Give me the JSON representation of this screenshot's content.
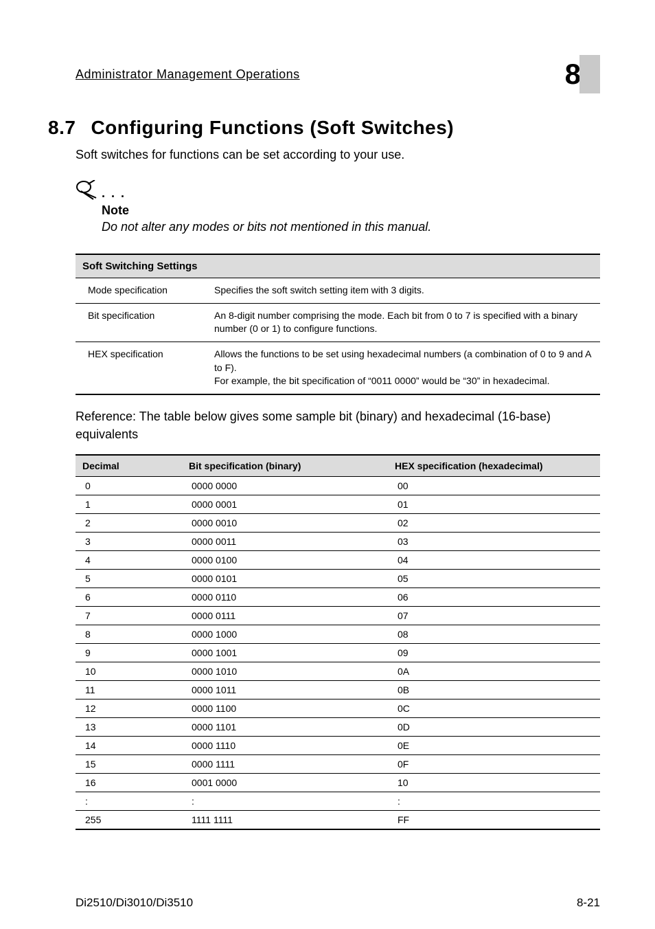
{
  "running_head": {
    "title": "Administrator Management Operations",
    "chapter_number": "8"
  },
  "section": {
    "number": "8.7",
    "title": "Configuring Functions (Soft Switches)",
    "intro": "Soft switches for functions can be set according to your use."
  },
  "note": {
    "label": "Note",
    "text": "Do not alter any modes or bits not mentioned in this manual."
  },
  "table1": {
    "header": "Soft Switching Settings",
    "rows": [
      {
        "c1": "Mode specification",
        "c2": "Specifies the soft switch setting item with 3 digits."
      },
      {
        "c1": "Bit specification",
        "c2": "An 8-digit number comprising the mode. Each bit from 0 to 7 is specified with a binary number (0 or 1) to configure functions."
      },
      {
        "c1": "HEX specification",
        "c2": "Allows the functions to be set using hexadecimal numbers (a combination of 0 to 9 and A to F).\nFor example, the bit specification of “0011 0000” would be “30” in hexadecimal."
      }
    ]
  },
  "reference_text": "Reference: The table below gives some sample bit (binary) and hexadecimal (16-base) equivalents",
  "table2": {
    "headers": [
      "Decimal",
      "Bit specification (binary)",
      "HEX specification (hexadecimal)"
    ],
    "rows": [
      {
        "dec": "0",
        "bin": "0000 0000",
        "hex": "00"
      },
      {
        "dec": "1",
        "bin": "0000 0001",
        "hex": "01"
      },
      {
        "dec": "2",
        "bin": "0000 0010",
        "hex": "02"
      },
      {
        "dec": "3",
        "bin": "0000 0011",
        "hex": "03"
      },
      {
        "dec": "4",
        "bin": "0000 0100",
        "hex": "04"
      },
      {
        "dec": "5",
        "bin": "0000 0101",
        "hex": "05"
      },
      {
        "dec": "6",
        "bin": "0000 0110",
        "hex": "06"
      },
      {
        "dec": "7",
        "bin": "0000 0111",
        "hex": "07"
      },
      {
        "dec": "8",
        "bin": "0000 1000",
        "hex": "08"
      },
      {
        "dec": "9",
        "bin": "0000 1001",
        "hex": "09"
      },
      {
        "dec": "10",
        "bin": "0000 1010",
        "hex": "0A"
      },
      {
        "dec": "11",
        "bin": "0000 1011",
        "hex": "0B"
      },
      {
        "dec": "12",
        "bin": "0000 1100",
        "hex": "0C"
      },
      {
        "dec": "13",
        "bin": "0000 1101",
        "hex": "0D"
      },
      {
        "dec": "14",
        "bin": "0000 1110",
        "hex": "0E"
      },
      {
        "dec": "15",
        "bin": "0000 1111",
        "hex": "0F"
      },
      {
        "dec": "16",
        "bin": "0001 0000",
        "hex": "10"
      },
      {
        "dec": ":",
        "bin": ":",
        "hex": ":"
      },
      {
        "dec": "255",
        "bin": "1111 1111",
        "hex": "FF"
      }
    ]
  },
  "footer": {
    "left": "Di2510/Di3010/Di3510",
    "right": "8-21"
  }
}
